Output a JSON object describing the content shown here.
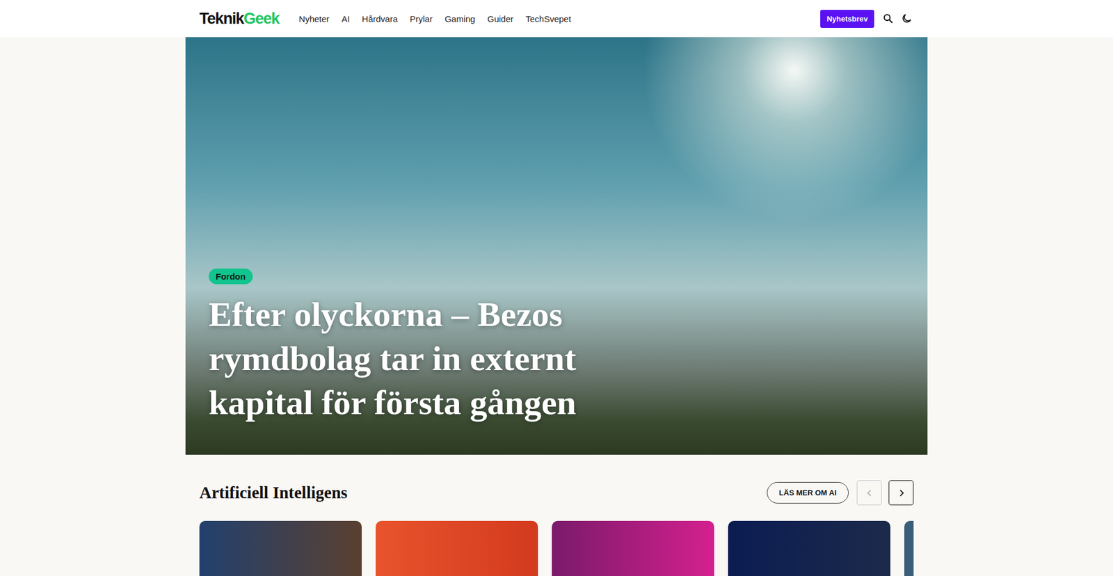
{
  "header": {
    "logo": {
      "first": "Teknik",
      "second": "Geek"
    },
    "nav": [
      {
        "label": "Nyheter"
      },
      {
        "label": "AI"
      },
      {
        "label": "Hårdvara"
      },
      {
        "label": "Prylar"
      },
      {
        "label": "Gaming"
      },
      {
        "label": "Guider"
      },
      {
        "label": "TechSvepet"
      }
    ],
    "newsletter_button": "Nyhetsbrev"
  },
  "hero": {
    "tag": "Fordon",
    "title": "Efter olyckorna – Bezos rymdbolag tar in externt kapital för första gången"
  },
  "section": {
    "title": "Artificiell Intelligens",
    "more_button": "LÄS MER OM AI",
    "prev": {
      "disabled": true
    },
    "next": {
      "disabled": false
    },
    "cards": [
      {},
      {},
      {},
      {},
      {}
    ]
  }
}
